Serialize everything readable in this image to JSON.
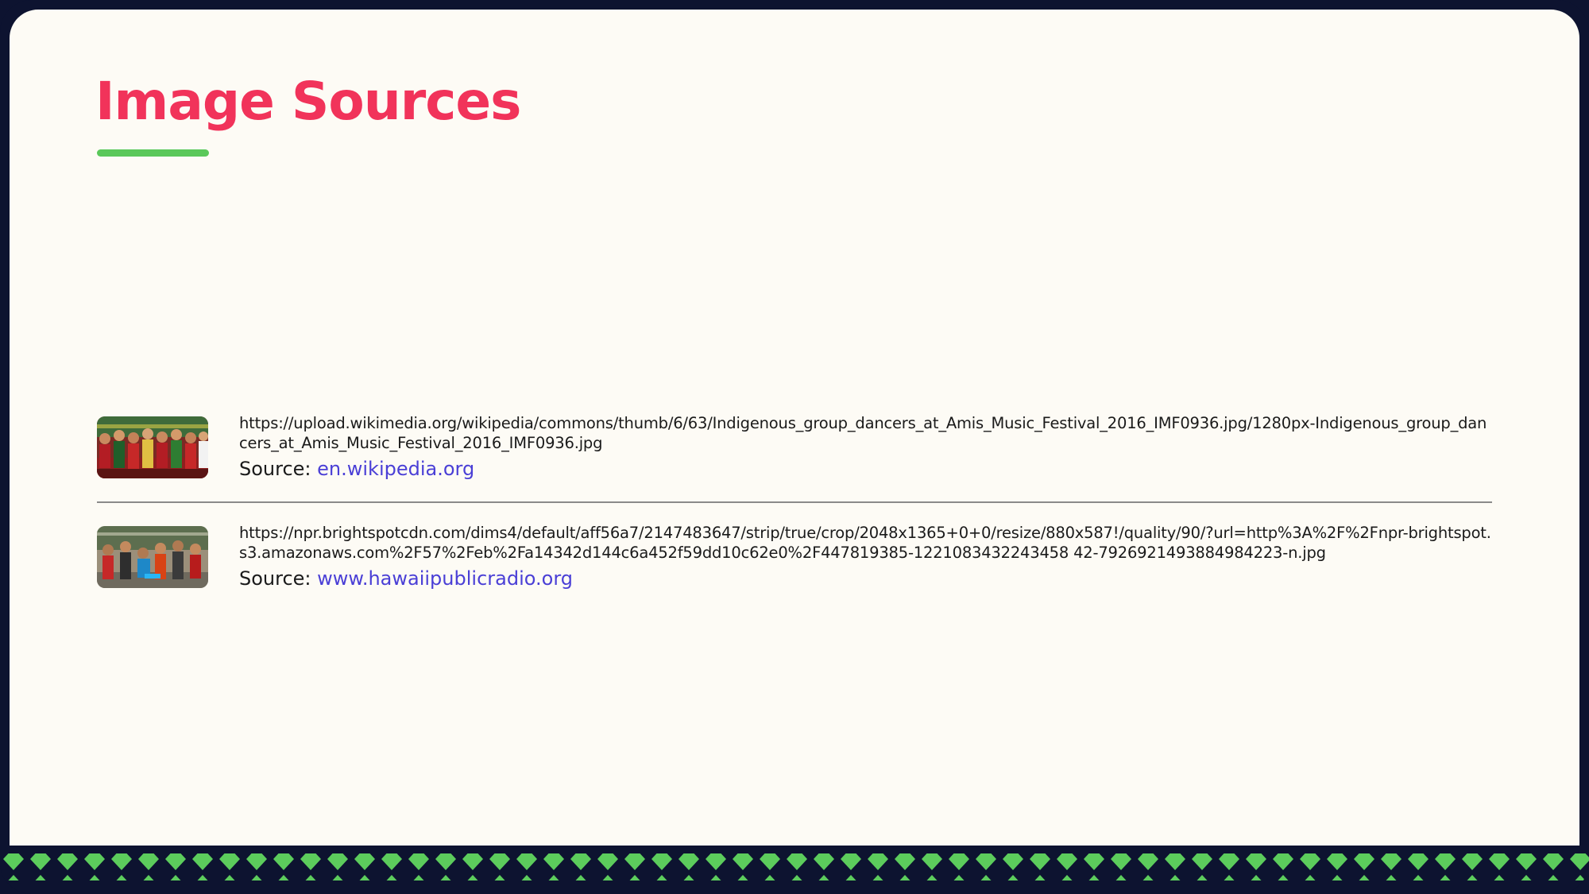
{
  "slide": {
    "title": "Image Sources"
  },
  "sources": [
    {
      "url": "https://upload.wikimedia.org/wikipedia/commons/thumb/6/63/Indigenous_group_dancers_at_Amis_Music_Festival_2016_IMF0936.jpg/1280px-Indigenous_group_dancers_at_Amis_Music_Festival_2016_IMF0936.jpg",
      "source_label": "Source: ",
      "source_link": "en.wikipedia.org"
    },
    {
      "url": "https://npr.brightspotcdn.com/dims4/default/aff56a7/2147483647/strip/true/crop/2048x1365+0+0/resize/880x587!/quality/90/?url=http%3A%2F%2Fnpr-brightspot.s3.amazonaws.com%2F57%2Feb%2Fa14342d144c6a452f59dd10c62e0%2F447819385-1221083432243458 42-7926921493884984223-n.jpg",
      "source_label": "Source: ",
      "source_link": "www.hawaiipublicradio.org"
    }
  ],
  "colors": {
    "frame": "#0d1330",
    "background": "#fdfbf5",
    "title": "#f1335a",
    "accent_green": "#5ac85a",
    "link": "#4a3fd6"
  }
}
